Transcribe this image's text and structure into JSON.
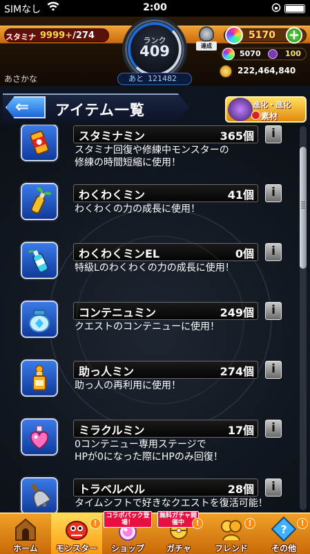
{
  "status_bar": {
    "carrier": "SIMなし",
    "time": "2:00"
  },
  "header": {
    "stamina_label": "スタミナ",
    "stamina_current": "9999+",
    "stamina_max": "/274",
    "rank_label": "ランク",
    "rank_value": "409",
    "next_label": "あと",
    "next_value": "121482",
    "achievement_label": "達成",
    "orbs": "5170",
    "rainbow_orbs": "5070",
    "tickets": "100",
    "gold": "222,464,840",
    "username": "あさかな"
  },
  "title_bar": {
    "back_glyph": "⇐",
    "title": "アイテム一覧",
    "evolve_line1": "進化・進化",
    "evolve_line2": "素材"
  },
  "items": [
    {
      "name": "スタミナミン",
      "count": "365個",
      "desc": "スタミナ回復や修練中モンスターの\n修練の時間短縮に使用！",
      "icon": "stamina-can-icon",
      "info": "i"
    },
    {
      "name": "わくわくミン",
      "count": "41個",
      "desc": "わくわくの力の成長に使用！",
      "icon": "sprout-bottle-icon",
      "info": "i"
    },
    {
      "name": "わくわくミンEL",
      "count": "0個",
      "desc": "特級Lのわくわくの力の成長に使用！",
      "icon": "el-bottle-icon",
      "info": "i"
    },
    {
      "name": "コンテニュミン",
      "count": "249個",
      "desc": "クエストのコンテニューに使用！",
      "icon": "continue-jar-icon",
      "info": "i"
    },
    {
      "name": "助っ人ミン",
      "count": "274個",
      "desc": "助っ人の再利用に使用！",
      "icon": "helper-bottle-icon",
      "info": "i"
    },
    {
      "name": "ミラクルミン",
      "count": "17個",
      "desc": "0コンテニュー専用ステージで\nHPが0になった際にHPのみ回復！",
      "icon": "heart-potion-icon",
      "info": "i"
    },
    {
      "name": "トラベルベル",
      "count": "28個",
      "desc": "タイムシフトで好きなクエストを復活可能！",
      "icon": "travel-bell-icon",
      "info": "i"
    }
  ],
  "bottom_nav": [
    {
      "label": "ホーム",
      "icon": "home-icon"
    },
    {
      "label": "モンスター",
      "icon": "monster-icon"
    },
    {
      "label": "ショップ",
      "icon": "shop-icon",
      "tag": "コラボパック登場！"
    },
    {
      "label": "ガチャ",
      "icon": "gacha-icon",
      "tag": "無料ガチャ開催中"
    },
    {
      "label": "フレンド",
      "icon": "friend-icon"
    },
    {
      "label": "その他",
      "icon": "other-icon"
    }
  ],
  "badge_glyph": "!",
  "colors": {
    "accent_orange": "#f0a028",
    "rank_blue": "#1d6bd8",
    "icon_blue": "#3a7ae8"
  }
}
